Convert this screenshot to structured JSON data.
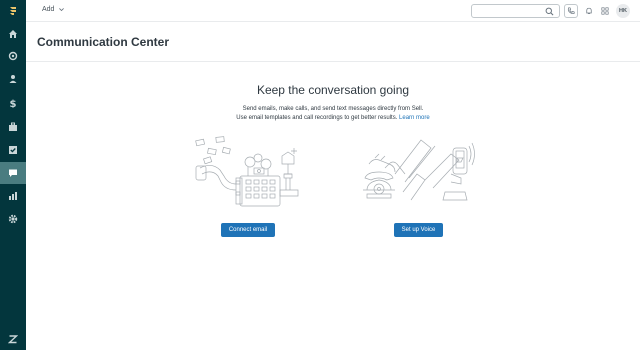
{
  "topbar": {
    "add_label": "Add",
    "search_placeholder": "",
    "avatar_initials": "HK"
  },
  "page": {
    "title": "Communication Center"
  },
  "main": {
    "headline": "Keep the conversation going",
    "description_line1": "Send emails, make calls, and send text messages directly from Sell.",
    "description_line2": "Use email templates and call recordings to get better results.",
    "learn_more": "Learn more",
    "connect_email_label": "Connect email",
    "setup_voice_label": "Set up Voice"
  },
  "colors": {
    "sidebar_bg": "#03363d",
    "sidebar_active": "#4a7c80",
    "primary_button": "#1f73b7",
    "link": "#1f73b7"
  },
  "icons": {
    "sidebar": [
      "sell-logo-icon",
      "home-icon",
      "leads-icon",
      "contacts-icon",
      "deals-icon",
      "tasks-icon",
      "checklist-icon",
      "communication-icon",
      "reports-icon",
      "settings-icon",
      "zendesk-logo-icon"
    ],
    "topbar": [
      "chevron-down-icon",
      "search-icon",
      "phone-icon",
      "bell-icon",
      "apps-grid-icon"
    ]
  }
}
